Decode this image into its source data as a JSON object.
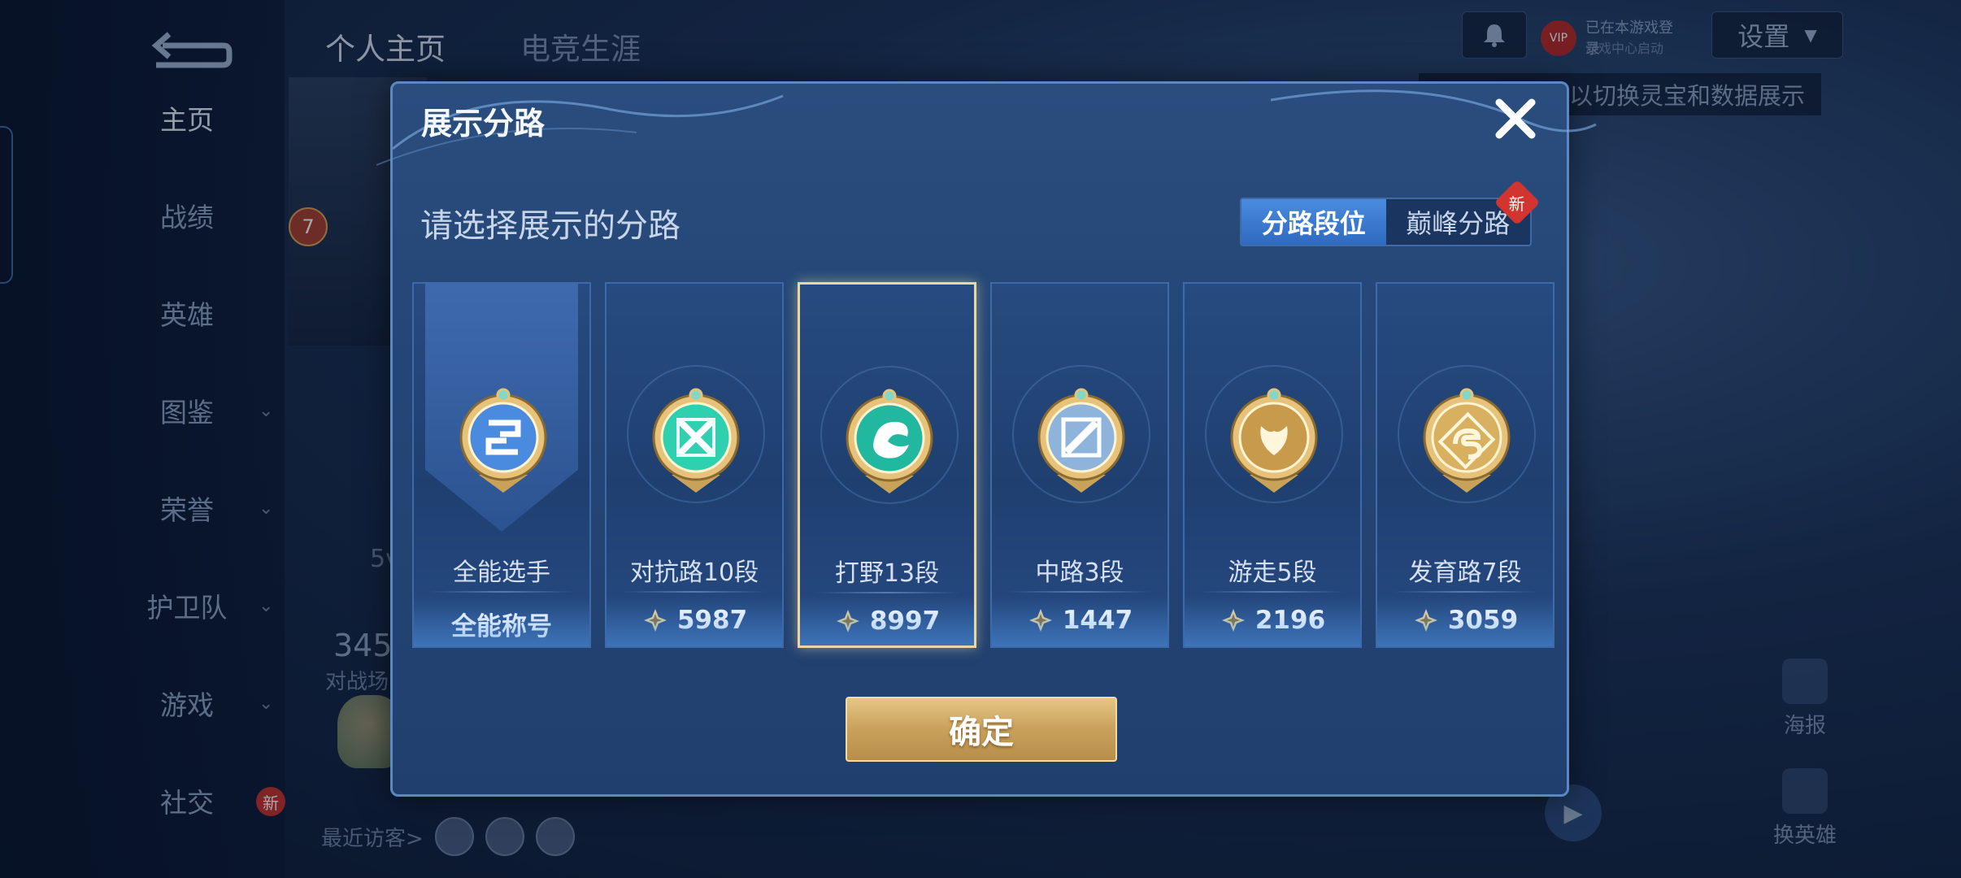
{
  "background": {
    "sidebar": [
      {
        "label": "主页",
        "active": true
      },
      {
        "label": "战绩"
      },
      {
        "label": "英雄"
      },
      {
        "label": "图鉴",
        "has_chevron": true
      },
      {
        "label": "荣誉",
        "has_chevron": true
      },
      {
        "label": "护卫队",
        "has_chevron": true
      },
      {
        "label": "游戏",
        "has_chevron": true
      },
      {
        "label": "社交",
        "has_chevron": true,
        "badge": "新"
      }
    ],
    "top_tabs": [
      "个人主页",
      "电竞生涯"
    ],
    "level_badge": "7",
    "stats_number": "345",
    "stats_label": "对战场",
    "partial_text": "5v",
    "recent_visitors_label": "最近访客>",
    "settings_label": "设置",
    "vip_badge": "VIP",
    "vip_line1": "已在本游戏登录",
    "vip_line2": "游戏中心启动",
    "hint_text": "以切换灵宝和数据展示",
    "right_icons": [
      {
        "label": "海报"
      },
      {
        "label": "换英雄"
      }
    ]
  },
  "modal": {
    "title": "展示分路",
    "subtitle": "请选择展示的分路",
    "segment": {
      "options": [
        "分路段位",
        "巅峰分路"
      ],
      "selected": "分路段位",
      "new_badge": "新"
    },
    "cards": [
      {
        "name": "全能选手",
        "value": "全能称号",
        "icon": "all-rounder-emblem-icon",
        "style": "banner",
        "color": "#4a8be0"
      },
      {
        "name": "对抗路10段",
        "value": "5987",
        "icon": "clash-lane-emblem-icon",
        "color": "#2fd0b0"
      },
      {
        "name": "打野13段",
        "value": "8997",
        "icon": "jungle-dragon-emblem-icon",
        "color": "#22b8a0",
        "selected": true
      },
      {
        "name": "中路3段",
        "value": "1447",
        "icon": "mid-lane-emblem-icon",
        "color": "#8fb4dc"
      },
      {
        "name": "游走5段",
        "value": "2196",
        "icon": "roam-emblem-icon",
        "color": "#c79a4c"
      },
      {
        "name": "发育路7段",
        "value": "3059",
        "icon": "farm-lane-emblem-icon",
        "color": "#d8b060"
      }
    ],
    "confirm_label": "确定"
  }
}
